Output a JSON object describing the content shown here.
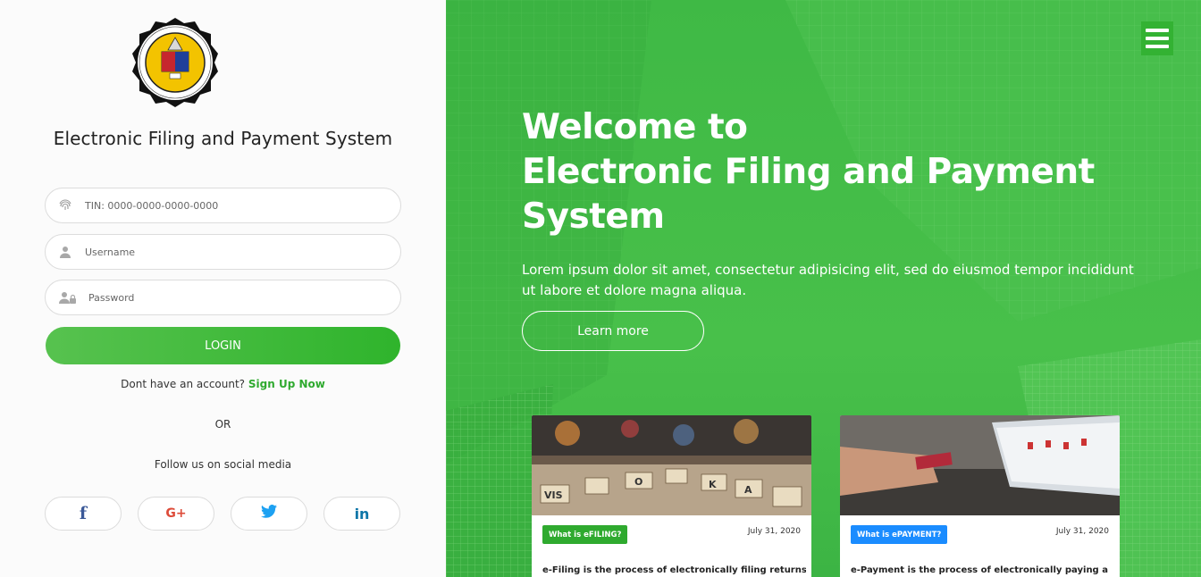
{
  "left": {
    "system_title": "Electronic Filing and Payment System",
    "seal_text": "BUREAU OF INTERNAL REVENUE · PHILIPPINES · 1904",
    "tin": {
      "placeholder": "TIN: 0000-0000-0000-0000",
      "value": ""
    },
    "username": {
      "placeholder": "Username",
      "value": ""
    },
    "password": {
      "placeholder": "Password",
      "value": ""
    },
    "login_label": "LOGIN",
    "signup_prompt": "Dont have an account?",
    "signup_link": "Sign Up Now",
    "or_label": "OR",
    "follow_label": "Follow us on social media",
    "social": [
      {
        "name": "facebook",
        "glyph": "f",
        "color": "#3b5998"
      },
      {
        "name": "google-plus",
        "glyph": "G+",
        "color": "#dd4b39"
      },
      {
        "name": "twitter",
        "glyph": "🐦",
        "color": "#1da1f2"
      },
      {
        "name": "linkedin",
        "glyph": "in",
        "color": "#0e76a8"
      }
    ]
  },
  "hero": {
    "title_line1": "Welcome to",
    "title_line2": "Electronic Filing and Payment",
    "title_line3": "System",
    "text": "Lorem ipsum dolor sit amet, consectetur adipisicing elit, sed do eiusmod tempor incididunt ut labore et dolore magna aliqua.",
    "learn_more": "Learn more"
  },
  "cards": [
    {
      "tag": "What is eFILING?",
      "tag_color": "#2faa2f",
      "date": "July 31, 2020",
      "excerpt": "e-Filing is the process of electronically filing returns"
    },
    {
      "tag": "What is ePAYMENT?",
      "tag_color": "#1a8cff",
      "date": "July 31, 2020",
      "excerpt": "e-Payment is the process of electronically paying a"
    }
  ],
  "colors": {
    "brand_green": "#3fb945",
    "link_green": "#2faa2f",
    "blue_tag": "#1a8cff"
  },
  "icons": [
    "fingerprint-icon",
    "user-icon",
    "users-lock-icon",
    "menu-icon",
    "facebook-icon",
    "google-plus-icon",
    "twitter-icon",
    "linkedin-icon"
  ]
}
